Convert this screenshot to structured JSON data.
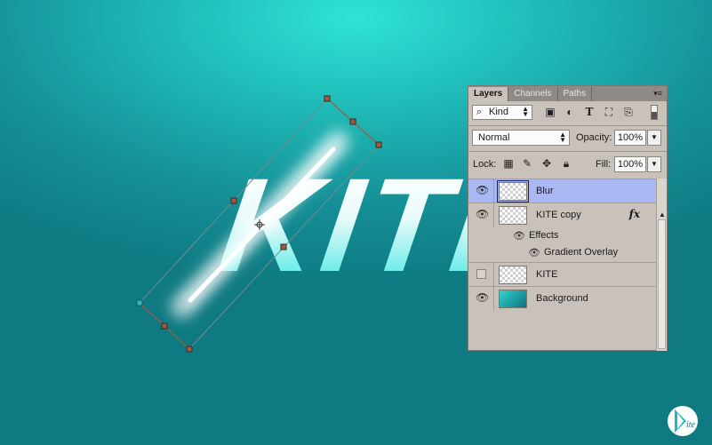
{
  "canvas": {
    "text": "KITE",
    "accent_color": "#1fb9b6",
    "selection_handle_color": "#a05a40"
  },
  "layers_panel": {
    "tabs": [
      {
        "label": "Layers",
        "active": true
      },
      {
        "label": "Channels",
        "active": false
      },
      {
        "label": "Paths",
        "active": false
      }
    ],
    "menu_icon": "panel-menu-icon",
    "filter": {
      "kind_label": "Kind",
      "icons": [
        "image-filter-icon",
        "adjustment-filter-icon",
        "type-filter-icon",
        "shape-filter-icon",
        "smart-object-filter-icon"
      ]
    },
    "blend_mode": "Normal",
    "opacity_label": "Opacity:",
    "opacity_value": "100%",
    "lock_label": "Lock:",
    "fill_label": "Fill:",
    "fill_value": "100%",
    "layers": [
      {
        "name": "Blur",
        "visible": true,
        "selected": true,
        "thumb": "transparent"
      },
      {
        "name": "KITE copy",
        "visible": true,
        "selected": false,
        "thumb": "transparent",
        "fx": "fx"
      },
      {
        "name": "KITE",
        "visible": false,
        "selected": false,
        "thumb": "transparent"
      },
      {
        "name": "Background",
        "visible": true,
        "selected": false,
        "thumb": "teal-gradient"
      }
    ],
    "effects_label": "Effects",
    "effect_item": "Gradient Overlay"
  },
  "logo": {
    "text": "ite",
    "brand_color": "#1fb9b6"
  }
}
